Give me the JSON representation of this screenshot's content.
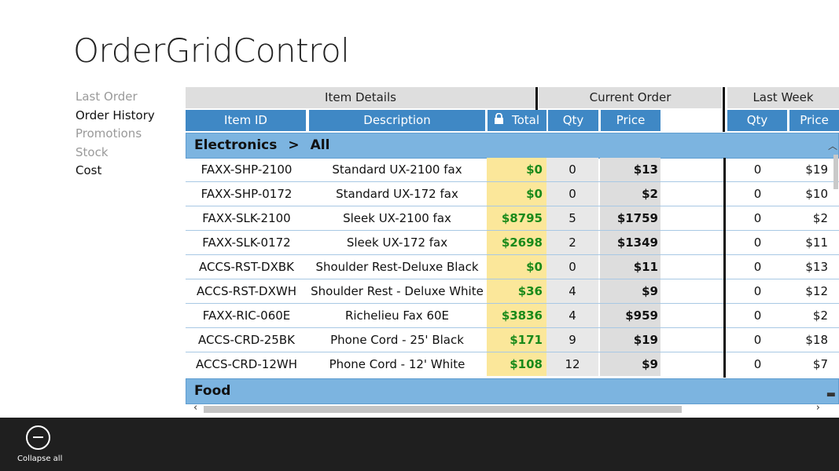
{
  "app": {
    "title": "OrderGridControl"
  },
  "nav": {
    "items": [
      {
        "label": "Last Order"
      },
      {
        "label": "Order History"
      },
      {
        "label": "Promotions"
      },
      {
        "label": "Stock"
      },
      {
        "label": "Cost"
      }
    ]
  },
  "grid": {
    "groups": [
      "Item Details",
      "Current Order",
      "Last Week"
    ],
    "columns": {
      "item_id": "Item ID",
      "description": "Description",
      "total": "Total",
      "qty": "Qty",
      "price": "Price",
      "lw_qty": "Qty",
      "lw_price": "Price"
    },
    "categories": [
      {
        "name": "Electronics",
        "separator": ">",
        "sub": "All"
      },
      {
        "name": "Food"
      }
    ],
    "rows": [
      {
        "id": "FAXX-SHP-2100",
        "desc": "Standard UX-2100 fax",
        "total": "$0",
        "qty": "0",
        "price": "$13",
        "lw_qty": "0",
        "lw_price": "$19"
      },
      {
        "id": "FAXX-SHP-0172",
        "desc": "Standard UX-172 fax",
        "total": "$0",
        "qty": "0",
        "price": "$2",
        "lw_qty": "0",
        "lw_price": "$10"
      },
      {
        "id": "FAXX-SLK-2100",
        "desc": "Sleek UX-2100 fax",
        "total": "$8795",
        "qty": "5",
        "price": "$1759",
        "lw_qty": "0",
        "lw_price": "$2"
      },
      {
        "id": "FAXX-SLK-0172",
        "desc": "Sleek UX-172 fax",
        "total": "$2698",
        "qty": "2",
        "price": "$1349",
        "lw_qty": "0",
        "lw_price": "$11"
      },
      {
        "id": "ACCS-RST-DXBK",
        "desc": "Shoulder Rest-Deluxe Black",
        "total": "$0",
        "qty": "0",
        "price": "$11",
        "lw_qty": "0",
        "lw_price": "$13"
      },
      {
        "id": "ACCS-RST-DXWH",
        "desc": "Shoulder Rest - Deluxe White",
        "total": "$36",
        "qty": "4",
        "price": "$9",
        "lw_qty": "0",
        "lw_price": "$12"
      },
      {
        "id": "FAXX-RIC-060E",
        "desc": "Richelieu Fax 60E",
        "total": "$3836",
        "qty": "4",
        "price": "$959",
        "lw_qty": "0",
        "lw_price": "$2"
      },
      {
        "id": "ACCS-CRD-25BK",
        "desc": "Phone Cord - 25' Black",
        "total": "$171",
        "qty": "9",
        "price": "$19",
        "lw_qty": "0",
        "lw_price": "$18"
      },
      {
        "id": "ACCS-CRD-12WH",
        "desc": "Phone Cord - 12' White",
        "total": "$108",
        "qty": "12",
        "price": "$9",
        "lw_qty": "0",
        "lw_price": "$7"
      }
    ]
  },
  "appbar": {
    "collapse_label": "Collapse all",
    "collapse_icon": "collapse-icon"
  },
  "colors": {
    "header_blue": "#3f88c5",
    "category_blue": "#7cb4e0",
    "total_yellow": "#fbe79a",
    "total_green": "#1a8a1a",
    "appbar": "#1f1f1f"
  }
}
